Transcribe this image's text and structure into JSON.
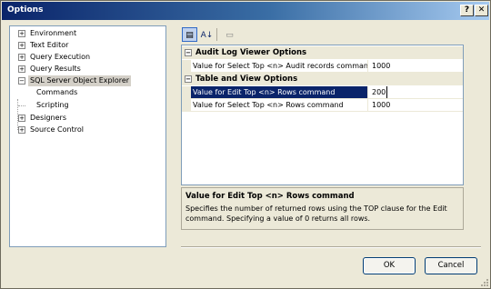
{
  "window": {
    "title": "Options",
    "help_glyph": "?",
    "close_glyph": "✕"
  },
  "tree": {
    "items": [
      {
        "label": "Environment",
        "expander": "+"
      },
      {
        "label": "Text Editor",
        "expander": "+"
      },
      {
        "label": "Query Execution",
        "expander": "+"
      },
      {
        "label": "Query Results",
        "expander": "+"
      },
      {
        "label": "SQL Server Object Explorer",
        "expander": "−",
        "selected": true
      },
      {
        "label": "Commands"
      },
      {
        "label": "Scripting"
      },
      {
        "label": "Designers",
        "expander": "+"
      },
      {
        "label": "Source Control",
        "expander": "+"
      }
    ]
  },
  "toolbar": {
    "categorized_icon": "categorized-icon",
    "alphabetical_icon": "alphabetical-icon",
    "property_pages_icon": "property-pages-icon",
    "categorized_glyph": "▤",
    "alphabetical_glyph": "A↓",
    "property_pages_glyph": "▭"
  },
  "grid": {
    "categories": [
      {
        "label": "Audit Log Viewer Options",
        "expander": "−",
        "rows": [
          {
            "name": "Value for Select Top <n> Audit records command",
            "value": "1000"
          }
        ]
      },
      {
        "label": "Table and View Options",
        "expander": "−",
        "rows": [
          {
            "name": "Value for Edit Top <n> Rows command",
            "value": "200",
            "selected": true
          },
          {
            "name": "Value for Select Top <n> Rows command",
            "value": "1000"
          }
        ]
      }
    ]
  },
  "description": {
    "title": "Value for Edit Top <n> Rows command",
    "text": "Specifies the number of returned rows using the TOP clause for the Edit command. Specifying a value of 0 returns all rows."
  },
  "buttons": {
    "ok": "OK",
    "cancel": "Cancel"
  }
}
